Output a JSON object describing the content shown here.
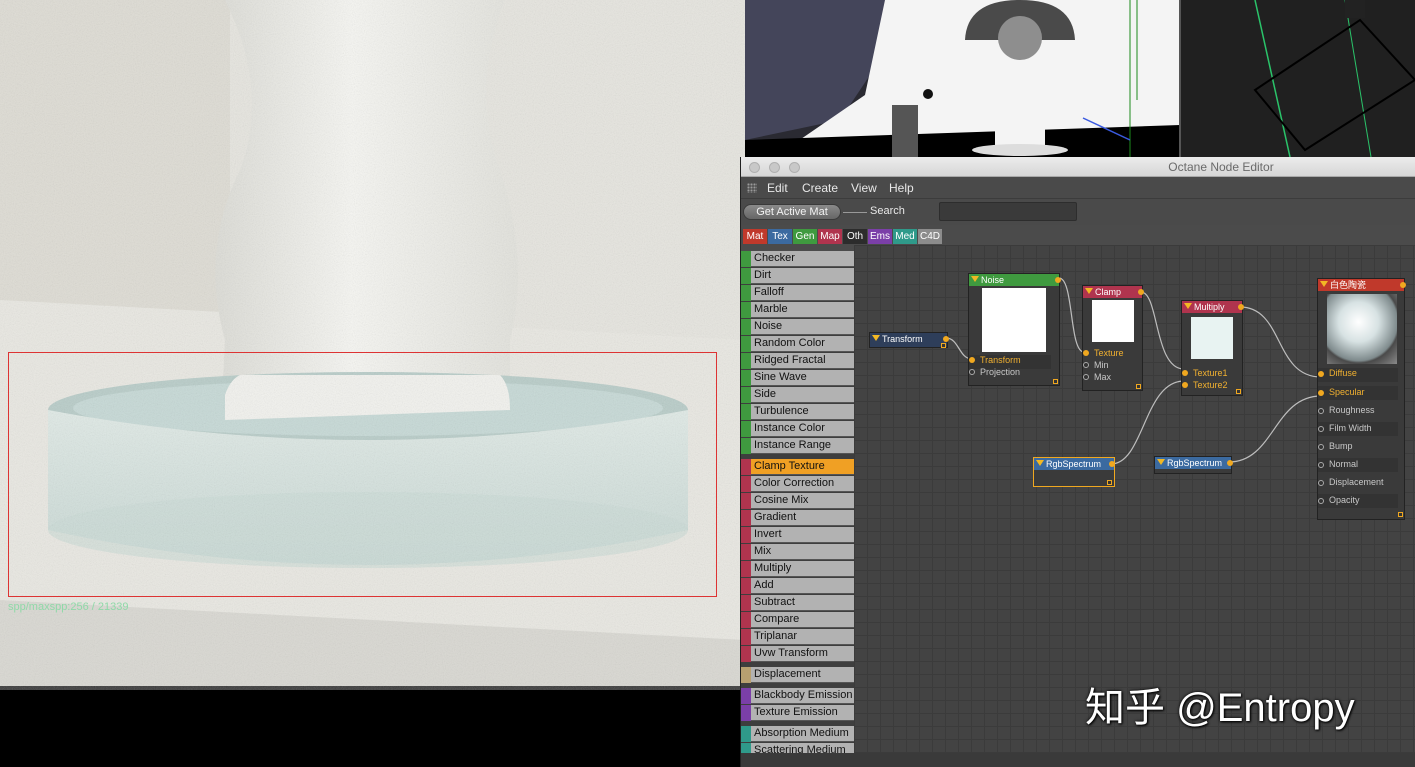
{
  "render": {
    "spp_text": "spp/maxspp:256 / 21339"
  },
  "editor": {
    "title": "Octane Node Editor",
    "menu": [
      "Edit",
      "Create",
      "View",
      "Help"
    ],
    "get_active_mat": "Get Active Mat",
    "search_label": "Search",
    "search_value": "",
    "categories": [
      {
        "label": "Mat",
        "color": "#c0392b"
      },
      {
        "label": "Tex",
        "color": "#3b6aa0"
      },
      {
        "label": "Gen",
        "color": "#3f9a3f"
      },
      {
        "label": "Map",
        "color": "#b0344e"
      },
      {
        "label": "Oth",
        "color": "#2c2c2c"
      },
      {
        "label": "Ems",
        "color": "#7b3fa8"
      },
      {
        "label": "Med",
        "color": "#2f9a8a"
      },
      {
        "label": "C4D",
        "color": "#8c8c8c"
      }
    ],
    "node_list": [
      {
        "label": "Checker",
        "group": "gen"
      },
      {
        "label": "Dirt",
        "group": "gen"
      },
      {
        "label": "Falloff",
        "group": "gen"
      },
      {
        "label": "Marble",
        "group": "gen"
      },
      {
        "label": "Noise",
        "group": "gen"
      },
      {
        "label": "Random Color",
        "group": "gen"
      },
      {
        "label": "Ridged Fractal",
        "group": "gen"
      },
      {
        "label": "Sine Wave",
        "group": "gen"
      },
      {
        "label": "Side",
        "group": "gen"
      },
      {
        "label": "Turbulence",
        "group": "gen"
      },
      {
        "label": "Instance Color",
        "group": "gen"
      },
      {
        "label": "Instance Range",
        "group": "gen"
      },
      {
        "label": "Clamp Texture",
        "group": "map",
        "selected": true
      },
      {
        "label": "Color Correction",
        "group": "map"
      },
      {
        "label": "Cosine Mix",
        "group": "map"
      },
      {
        "label": "Gradient",
        "group": "map"
      },
      {
        "label": "Invert",
        "group": "map"
      },
      {
        "label": "Mix",
        "group": "map"
      },
      {
        "label": "Multiply",
        "group": "map"
      },
      {
        "label": "Add",
        "group": "map"
      },
      {
        "label": "Subtract",
        "group": "map"
      },
      {
        "label": "Compare",
        "group": "map"
      },
      {
        "label": "Triplanar",
        "group": "map"
      },
      {
        "label": "Uvw Transform",
        "group": "map"
      },
      {
        "label": "Displacement",
        "group": "disp"
      },
      {
        "label": "Blackbody Emission",
        "group": "ems"
      },
      {
        "label": "Texture Emission",
        "group": "ems"
      },
      {
        "label": "Absorption Medium",
        "group": "med"
      },
      {
        "label": "Scattering Medium",
        "group": "med"
      }
    ],
    "group_colors": {
      "gen": "#3f9a3f",
      "map": "#b0344e",
      "disp": "#b8a070",
      "ems": "#7b3fa8",
      "med": "#2f9a8a"
    },
    "nodes": {
      "transform": {
        "title": "Transform",
        "color": "#2e3e5a"
      },
      "noise": {
        "title": "Noise",
        "color": "#3f9a3f",
        "ports": [
          "Transform",
          "Projection"
        ]
      },
      "clamp": {
        "title": "Clamp",
        "color": "#b0344e",
        "ports": [
          "Texture",
          "Min",
          "Max"
        ]
      },
      "multiply": {
        "title": "Multiply",
        "color": "#b0344e",
        "ports": [
          "Texture1",
          "Texture2"
        ]
      },
      "rgb1": {
        "title": "RgbSpectrum",
        "color": "#3b6aa0"
      },
      "rgb2": {
        "title": "RgbSpectrum",
        "color": "#3b6aa0"
      },
      "material": {
        "title": "白色陶瓷",
        "color": "#c0392b",
        "ports": [
          "Diffuse",
          "Specular",
          "Roughness",
          "Film Width",
          "Bump",
          "Normal",
          "Displacement",
          "Opacity"
        ]
      }
    }
  },
  "watermark": "知乎 @Entropy"
}
